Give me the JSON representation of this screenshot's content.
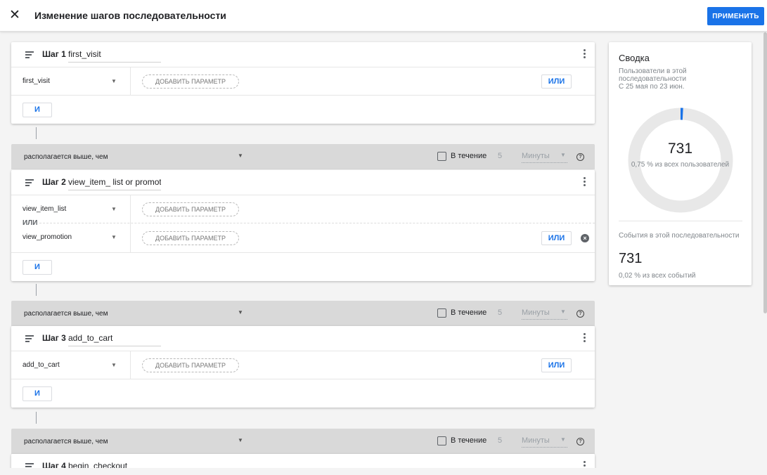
{
  "header": {
    "close_icon": "close-icon",
    "title": "Изменение шагов последовательности",
    "apply_label": "ПРИМЕНИТЬ"
  },
  "colors": {
    "primary": "#1a73e8",
    "relation_bar": "#d9d9d9",
    "donut_track": "#e8e8e8"
  },
  "steps": [
    {
      "label": "Шаг 1",
      "name": "first_visit",
      "events": [
        "first_visit"
      ],
      "add_param": "ДОБАВИТЬ ПАРАМЕТР",
      "or_label": "ИЛИ",
      "and_label": "И"
    },
    {
      "label": "Шаг 2",
      "name": "view_item_ list or promoti",
      "events": [
        "view_item_list",
        "view_promotion"
      ],
      "or_separator": "ИЛИ",
      "add_param": "ДОБАВИТЬ ПАРАМЕТР",
      "or_label": "ИЛИ",
      "and_label": "И"
    },
    {
      "label": "Шаг 3",
      "name": "add_to_cart",
      "events": [
        "add_to_cart"
      ],
      "add_param": "ДОБАВИТЬ ПАРАМЕТР",
      "or_label": "ИЛИ",
      "and_label": "И"
    },
    {
      "label": "Шаг 4",
      "name": "begin_checkout"
    }
  ],
  "relations": [
    {
      "select": "располагается выше, чем",
      "within_label": "В течение",
      "within_value": "5",
      "unit": "Минуты",
      "checked": false
    },
    {
      "select": "располагается выше, чем",
      "within_label": "В течение",
      "within_value": "5",
      "unit": "Минуты",
      "checked": false
    },
    {
      "select": "располагается выше, чем",
      "within_label": "В течение",
      "within_value": "5",
      "unit": "Минуты",
      "checked": false
    }
  ],
  "summary": {
    "title": "Сводка",
    "users_label": "Пользователи в этой последовательности",
    "date_range": "С 25 мая по 23 июн.",
    "users_count": "731",
    "users_pct": "0,75 % из всех пользователей",
    "users_fraction": 0.0075,
    "events_label": "События в этой последовательности",
    "events_count": "731",
    "events_pct": "0,02 % из всех событий"
  }
}
